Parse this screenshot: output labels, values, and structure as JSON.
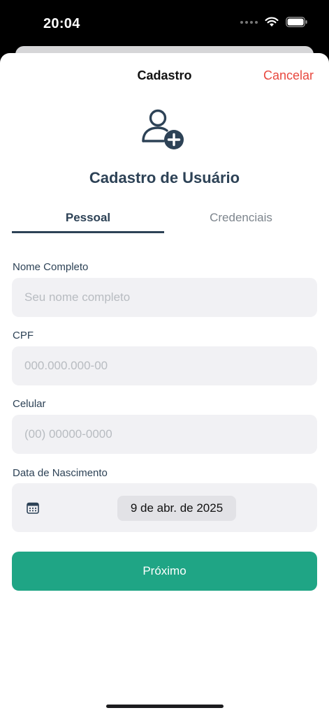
{
  "status_bar": {
    "time": "20:04"
  },
  "nav": {
    "title": "Cadastro",
    "cancel_label": "Cancelar"
  },
  "header": {
    "icon": "user-plus-icon",
    "title": "Cadastro de Usuário"
  },
  "tabs": [
    {
      "label": "Pessoal",
      "active": true
    },
    {
      "label": "Credenciais",
      "active": false
    }
  ],
  "form": {
    "full_name": {
      "label": "Nome Completo",
      "value": "",
      "placeholder": "Seu nome completo"
    },
    "cpf": {
      "label": "CPF",
      "value": "",
      "placeholder": "000.000.000-00"
    },
    "phone": {
      "label": "Celular",
      "value": "",
      "placeholder": "(00) 00000-0000"
    },
    "birth_date": {
      "label": "Data de Nascimento",
      "value": "9 de abr. de 2025",
      "icon": "calendar-icon"
    }
  },
  "actions": {
    "next_label": "Próximo"
  },
  "colors": {
    "primary_text": "#2d4256",
    "accent": "#1fa585",
    "cancel": "#e8483f",
    "input_bg": "#f1f1f4"
  }
}
